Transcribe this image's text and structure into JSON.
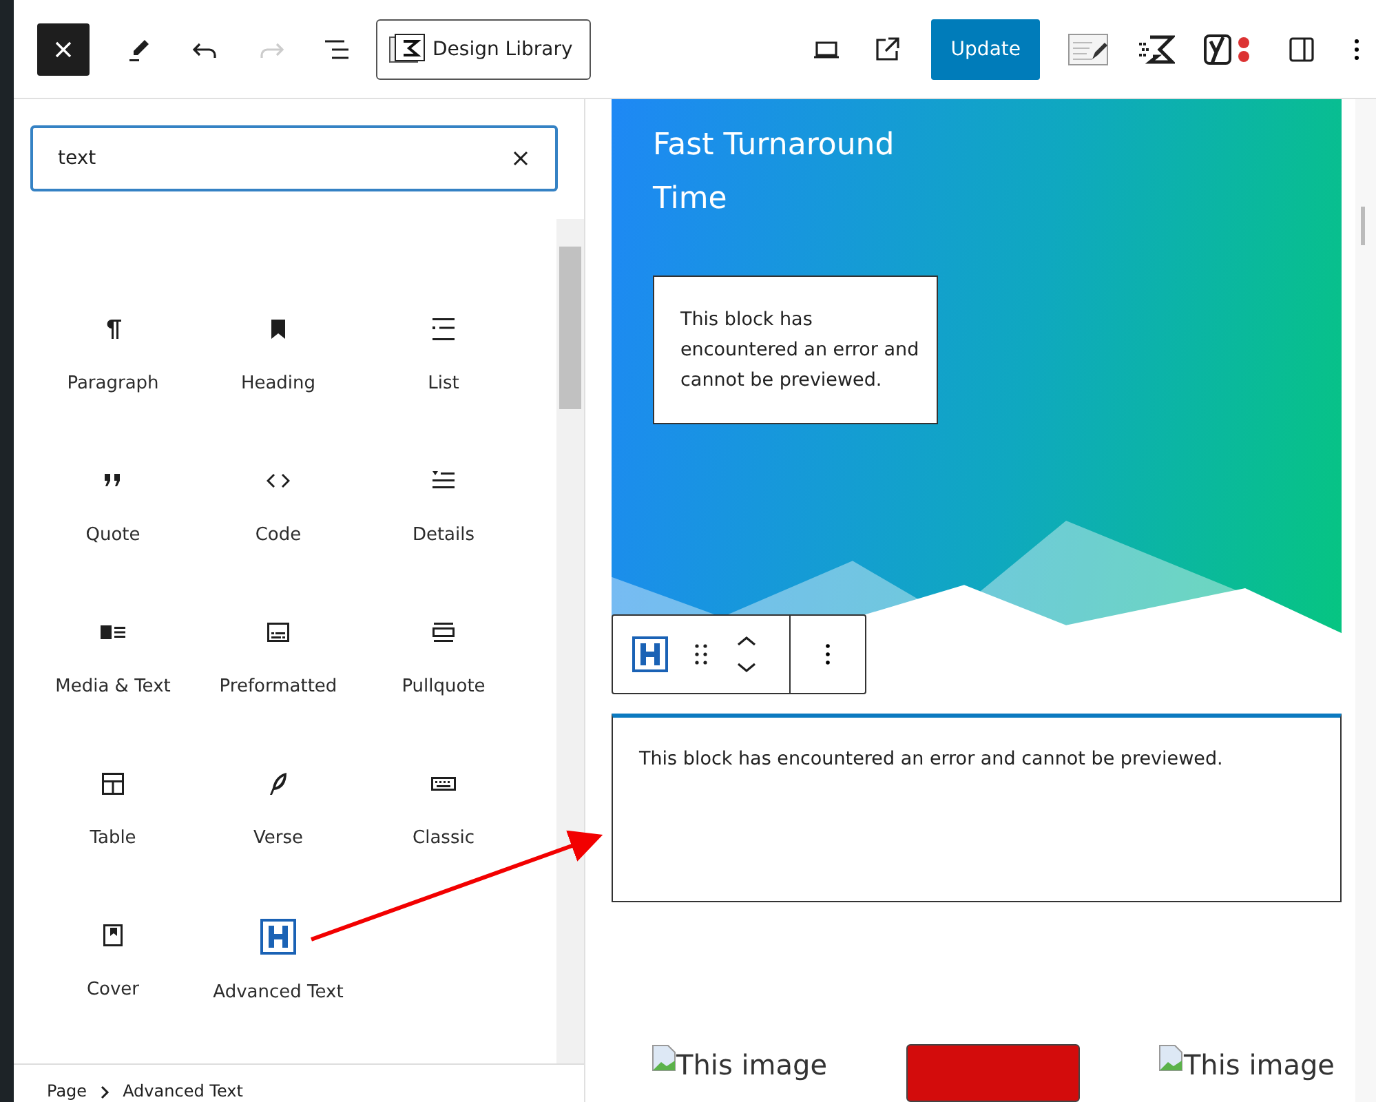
{
  "toolbar": {
    "design_library": "Design Library",
    "update": "Update"
  },
  "inserter": {
    "search_value": "text",
    "blocks": [
      {
        "label": "Paragraph",
        "kind": "core"
      },
      {
        "label": "Heading",
        "kind": "core"
      },
      {
        "label": "List",
        "kind": "core"
      },
      {
        "label": "Quote",
        "kind": "core"
      },
      {
        "label": "Code",
        "kind": "core"
      },
      {
        "label": "Details",
        "kind": "core"
      },
      {
        "label": "Media & Text",
        "kind": "core"
      },
      {
        "label": "Preformatted",
        "kind": "core"
      },
      {
        "label": "Pullquote",
        "kind": "core"
      },
      {
        "label": "Table",
        "kind": "core"
      },
      {
        "label": "Verse",
        "kind": "core"
      },
      {
        "label": "Classic",
        "kind": "core"
      },
      {
        "label": "Cover",
        "kind": "core"
      },
      {
        "label": "Advanced Text",
        "kind": "plugin"
      }
    ]
  },
  "canvas": {
    "hero_title": "Fast Turnaround Time",
    "hero_error": "This block has encountered an error and cannot be previewed.",
    "block_error": "This block has encountered an error and cannot be previewed.",
    "images": [
      "This image",
      "This image"
    ]
  },
  "breadcrumb": [
    "Page",
    "Advanced Text"
  ]
}
